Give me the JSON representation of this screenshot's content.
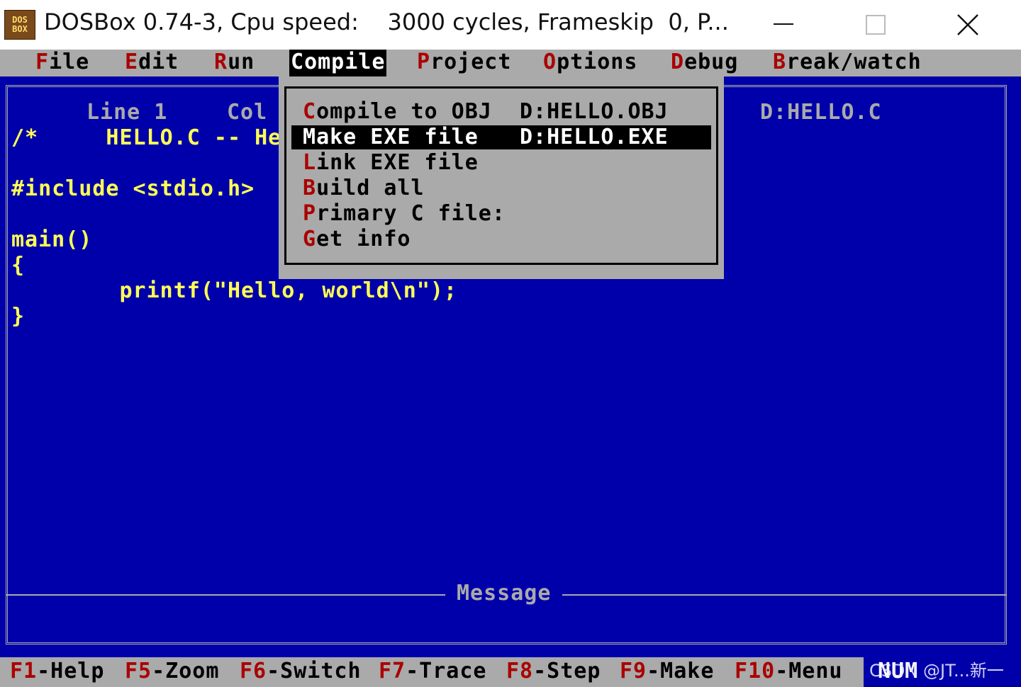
{
  "window": {
    "icon_text_line1": "DOS",
    "icon_text_line2": "BOX",
    "title": "DOSBox 0.74-3, Cpu speed:    3000 cycles, Frameskip  0, P..."
  },
  "menu": [
    {
      "hotkey": "F",
      "rest": "ile"
    },
    {
      "hotkey": "E",
      "rest": "dit"
    },
    {
      "hotkey": "R",
      "rest": "un"
    },
    {
      "hotkey": "C",
      "rest": "ompile"
    },
    {
      "hotkey": "P",
      "rest": "roject"
    },
    {
      "hotkey": "O",
      "rest": "ptions"
    },
    {
      "hotkey": "D",
      "rest": "ebug"
    },
    {
      "hotkey": "B",
      "rest": "reak/watch"
    }
  ],
  "editor": {
    "line_label": "Line 1",
    "col_label": "Col",
    "filename": "D:HELLO.C",
    "code": [
      "/*     HELLO.C -- He",
      "",
      "#include <stdio.h>",
      "",
      "main()",
      "{",
      "        printf(\"Hello, world\\n\");",
      "}"
    ],
    "message_label": "Message"
  },
  "compile_menu": [
    {
      "hotkey": "C",
      "rest": "ompile to OBJ",
      "value": "D:HELLO.OBJ",
      "selected": false
    },
    {
      "hotkey": "M",
      "rest": "ake EXE file",
      "value": "D:HELLO.EXE",
      "selected": true
    },
    {
      "hotkey": "L",
      "rest": "ink EXE file",
      "value": "",
      "selected": false
    },
    {
      "hotkey": "B",
      "rest": "uild all",
      "value": "",
      "selected": false
    },
    {
      "hotkey": "P",
      "rest": "rimary C file:",
      "value": "",
      "selected": false
    },
    {
      "hotkey": "G",
      "rest": "et info",
      "value": "",
      "selected": false
    }
  ],
  "fkeys": [
    {
      "key": "F1",
      "label": "-Help"
    },
    {
      "key": "F5",
      "label": "-Zoom"
    },
    {
      "key": "F6",
      "label": "-Switch"
    },
    {
      "key": "F7",
      "label": "-Trace"
    },
    {
      "key": "F8",
      "label": "-Step"
    },
    {
      "key": "F9",
      "label": "-Make"
    },
    {
      "key": "F10",
      "label": "-Menu"
    }
  ],
  "num_indicator": "NUM",
  "watermark": "CSDN @JT...新一",
  "colors": {
    "background": "#0000aa",
    "menu_gray": "#aaaaaa",
    "hotkey_red": "#aa0000",
    "code_yellow": "#ffff55"
  }
}
